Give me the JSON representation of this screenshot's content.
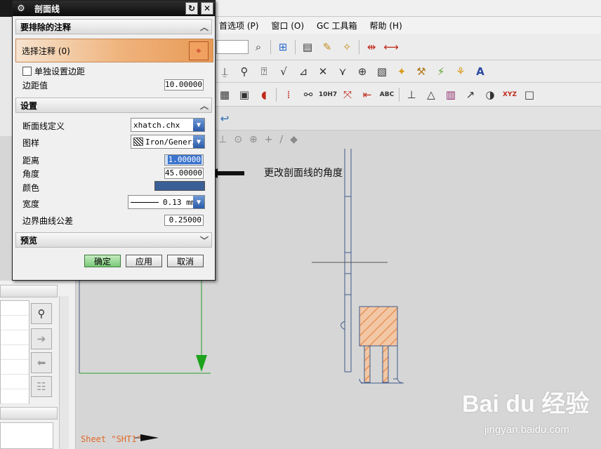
{
  "menubar": {
    "items": [
      "首选项 (P)",
      "窗口 (O)",
      "GC 工具箱",
      "帮助 (H)"
    ]
  },
  "toolbar": {
    "text_icons": {
      "abc": "ABC",
      "tol": "10H7",
      "xyz": "XYZ"
    }
  },
  "dialog": {
    "title": "剖面线",
    "section_exclude": "要排除的注释",
    "select_label": "选择注释 (0)",
    "separate_margin_label": "单独设置边距",
    "margin_label": "边距值",
    "margin_value": "10.00000",
    "section_settings": "设置",
    "hatch_def_label": "断面线定义",
    "hatch_def_value": "xhatch.chx",
    "pattern_label": "图样",
    "pattern_value": "Iron/Generic",
    "distance_label": "距离",
    "distance_value": "1.00000",
    "angle_label": "角度",
    "angle_value": "45.00000",
    "color_label": "颜色",
    "color_value": "#3a5f96",
    "width_label": "宽度",
    "width_value": "0.13 mm",
    "tolerance_label": "边界曲线公差",
    "tolerance_value": "0.25000",
    "section_preview": "预览",
    "ok_label": "确定",
    "apply_label": "应用",
    "cancel_label": "取消"
  },
  "annotation": {
    "text": "更改剖面线的角度"
  },
  "sheet_label": "Sheet \"SHT1\"",
  "watermark": {
    "brand": "Bai du 经验",
    "url": "jingyan.baidu.com"
  },
  "colors": {
    "hatch": "#e9935a",
    "geometry": "#3d5a8a",
    "green_arrow": "#1fa31f"
  }
}
